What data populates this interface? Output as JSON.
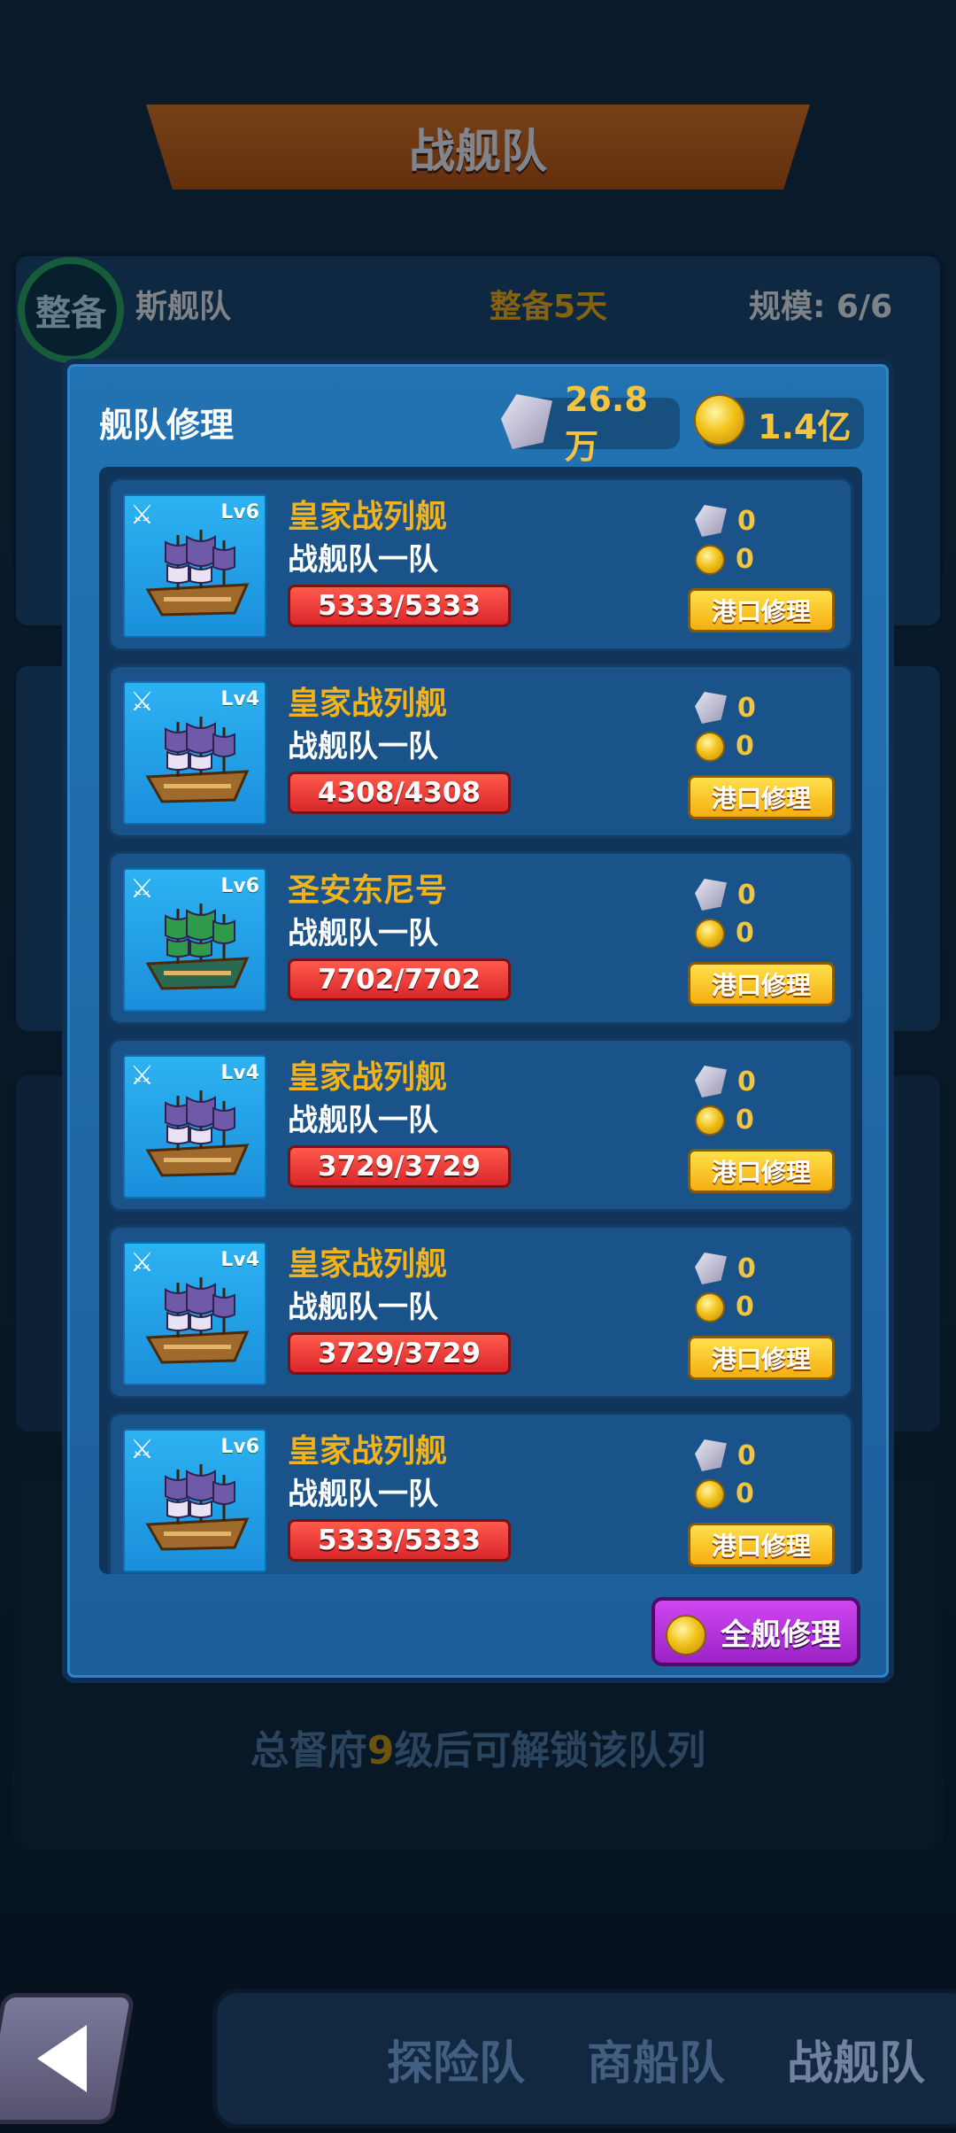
{
  "background": {
    "title": "战舰队",
    "card1": {
      "name": "斯舰队",
      "status": "整备5天",
      "scale": "规模: 6/6",
      "badge": "整备"
    },
    "lock_text_prefix": "总督府",
    "lock_text_level": "9",
    "lock_text_suffix": "级后可解锁该队列"
  },
  "modal": {
    "title": "舰队修理",
    "gems": "26.8万",
    "coins": "1.4亿",
    "repair_button_label": "港口修理",
    "repair_all_label": "全舰修理",
    "ships": [
      {
        "level": "Lv6",
        "name": "皇家战列舰",
        "fleet": "战舰队一队",
        "hp": "5333/5333",
        "gem_cost": "0",
        "coin_cost": "0",
        "type": "royal"
      },
      {
        "level": "Lv4",
        "name": "皇家战列舰",
        "fleet": "战舰队一队",
        "hp": "4308/4308",
        "gem_cost": "0",
        "coin_cost": "0",
        "type": "royal"
      },
      {
        "level": "Lv6",
        "name": "圣安东尼号",
        "fleet": "战舰队一队",
        "hp": "7702/7702",
        "gem_cost": "0",
        "coin_cost": "0",
        "type": "green"
      },
      {
        "level": "Lv4",
        "name": "皇家战列舰",
        "fleet": "战舰队一队",
        "hp": "3729/3729",
        "gem_cost": "0",
        "coin_cost": "0",
        "type": "royal"
      },
      {
        "level": "Lv4",
        "name": "皇家战列舰",
        "fleet": "战舰队一队",
        "hp": "3729/3729",
        "gem_cost": "0",
        "coin_cost": "0",
        "type": "royal"
      },
      {
        "level": "Lv6",
        "name": "皇家战列舰",
        "fleet": "战舰队一队",
        "hp": "5333/5333",
        "gem_cost": "0",
        "coin_cost": "0",
        "type": "royal"
      }
    ]
  },
  "nav": {
    "tabs": [
      "探险队",
      "商船队",
      "战舰队"
    ],
    "active_tab": "战舰队"
  }
}
